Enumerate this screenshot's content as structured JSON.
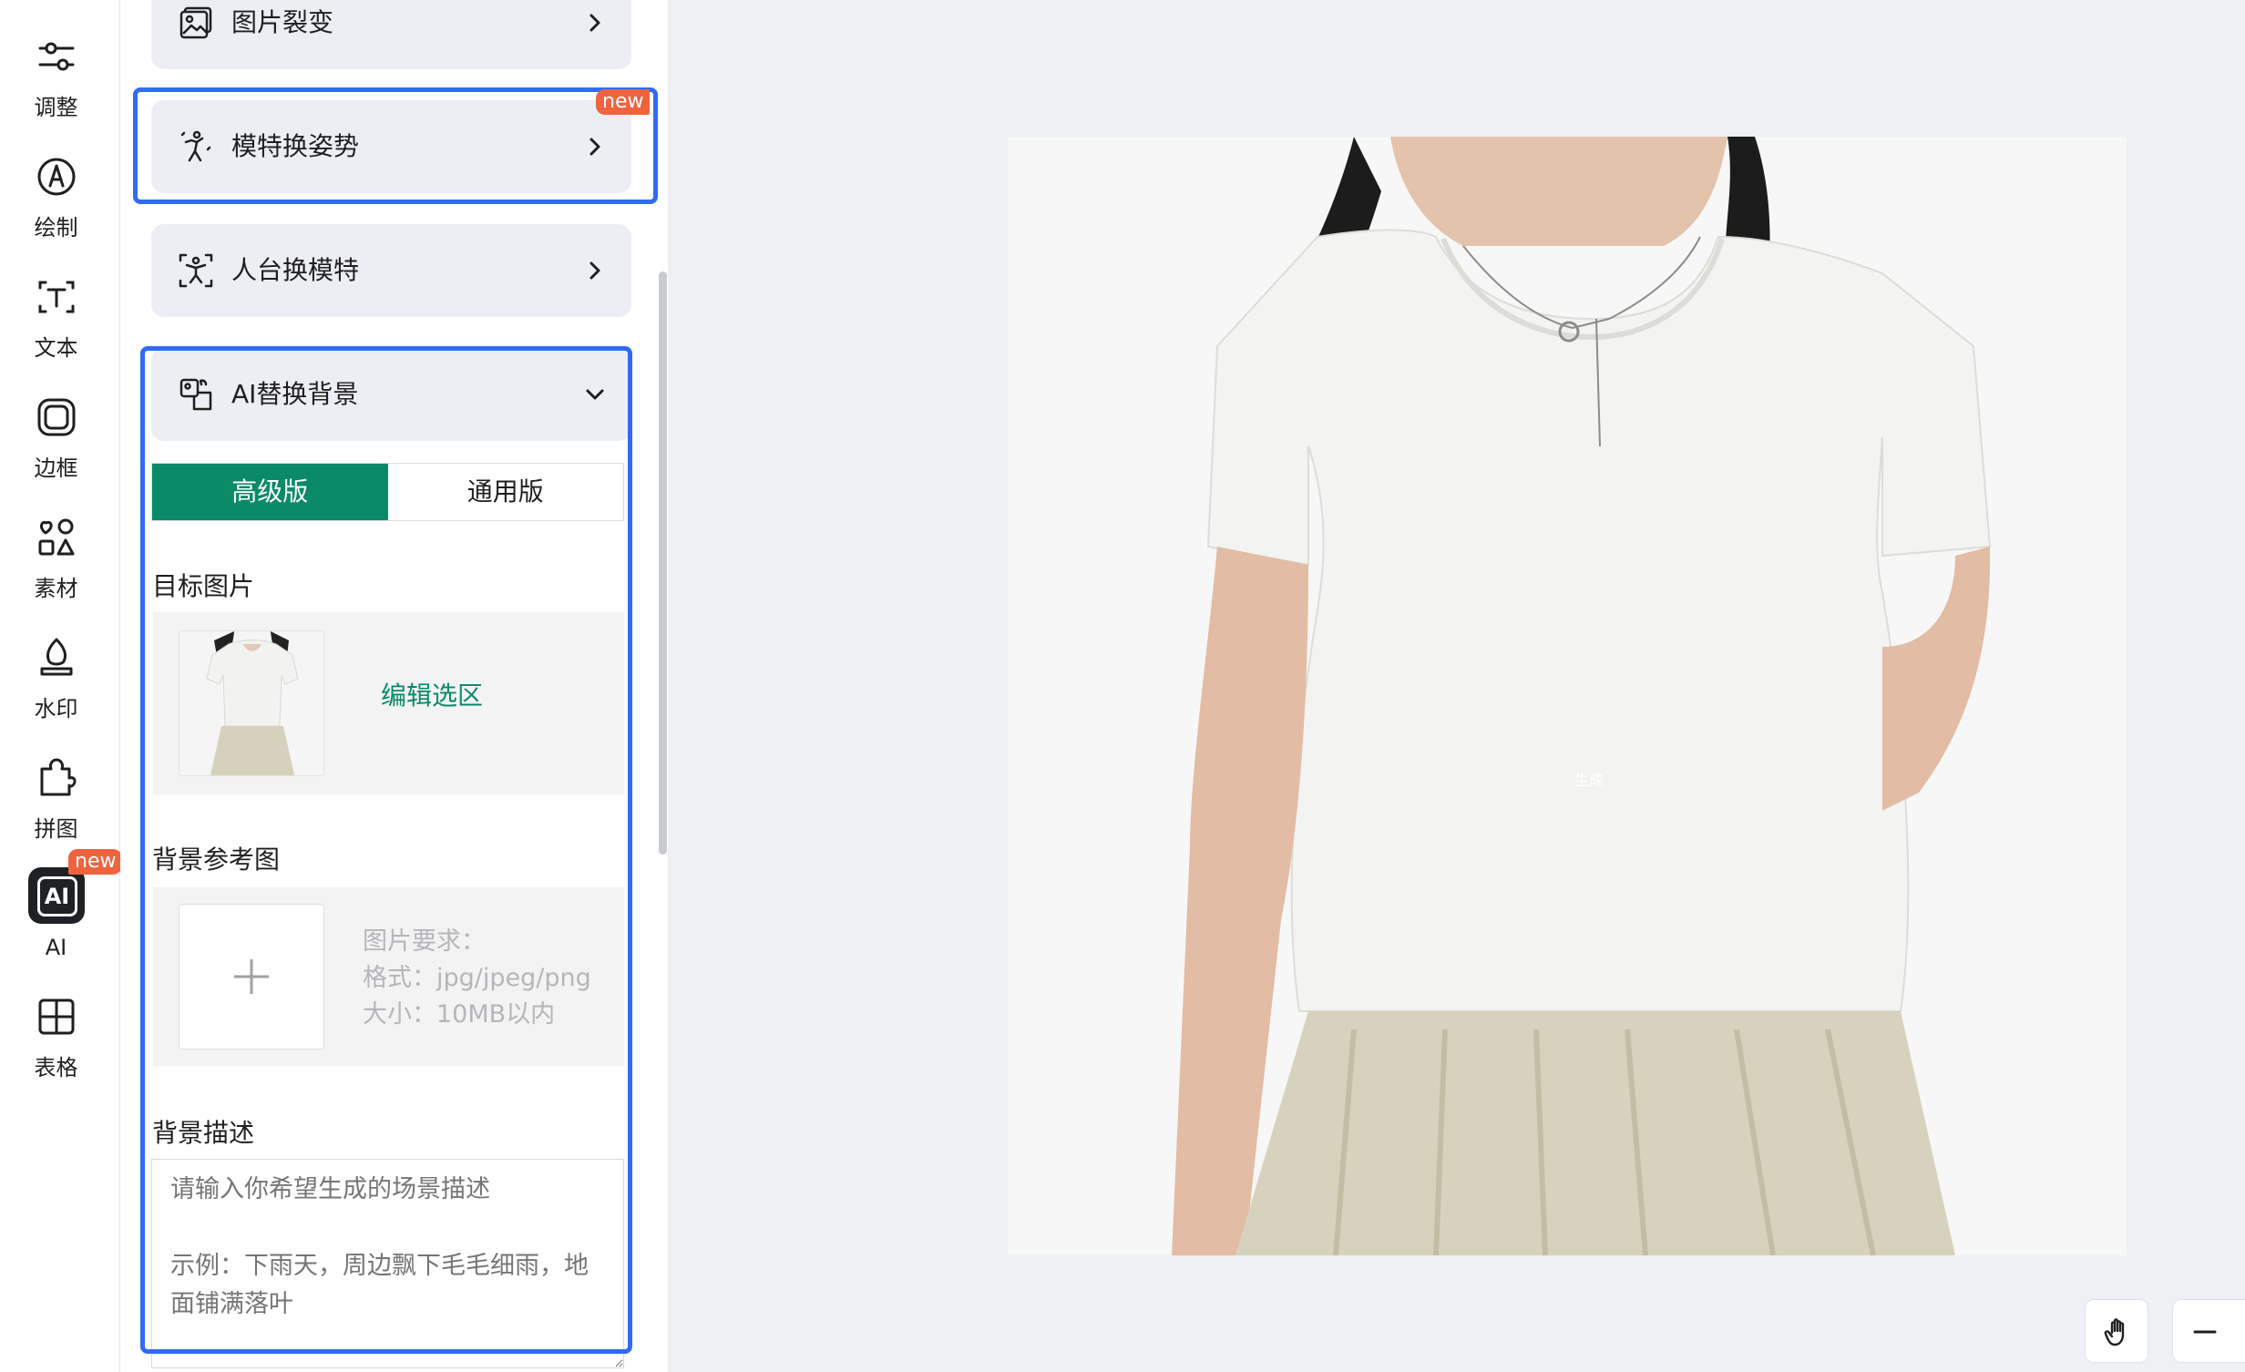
{
  "rail": {
    "items": [
      {
        "label": "调整",
        "icon": "sliders-icon"
      },
      {
        "label": "绘制",
        "icon": "draw-icon"
      },
      {
        "label": "文本",
        "icon": "text-icon"
      },
      {
        "label": "边框",
        "icon": "border-icon"
      },
      {
        "label": "素材",
        "icon": "material-icon"
      },
      {
        "label": "水印",
        "icon": "watermark-icon"
      },
      {
        "label": "拼图",
        "icon": "puzzle-icon"
      },
      {
        "label": "AI",
        "icon": "ai-icon",
        "badge": "new",
        "active": true
      },
      {
        "label": "表格",
        "icon": "table-icon"
      }
    ]
  },
  "panel": {
    "cards": [
      {
        "title": "图片裂变",
        "icon": "image-icon"
      },
      {
        "title": "模特换姿势",
        "icon": "pose-icon",
        "badge": "new"
      },
      {
        "title": "人台换模特",
        "icon": "mannequin-icon"
      }
    ],
    "ai_bg": {
      "title": "AI替换背景",
      "tabs": [
        {
          "label": "高级版",
          "active": true
        },
        {
          "label": "通用版",
          "active": false
        }
      ],
      "target_label": "目标图片",
      "edit_selection": "编辑选区",
      "ref_label": "背景参考图",
      "req_line1": "图片要求：",
      "req_line2": "格式：jpg/jpeg/png",
      "req_line3": "大小：10MB以内",
      "desc_label": "背景描述",
      "desc_placeholder": "请输入你希望生成的场景描述\n\n示例：下雨天，周边飘下毛毛细雨，地面铺满落叶"
    }
  },
  "canvas": {
    "watermark": "生成"
  },
  "colors": {
    "accent_green": "#0a8a67",
    "highlight_blue": "#2f6cf6",
    "new_badge": "#f0633f"
  }
}
